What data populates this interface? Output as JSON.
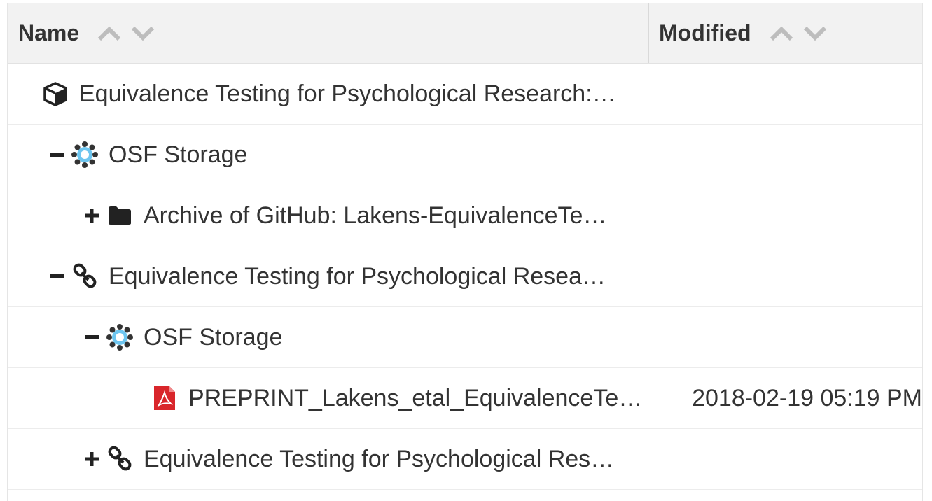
{
  "header": {
    "name_label": "Name",
    "modified_label": "Modified"
  },
  "rows": [
    {
      "label": "Equivalence Testing for Psychological Research:…",
      "icon": "cube-icon",
      "toggle": "",
      "modified": ""
    },
    {
      "label": "OSF Storage",
      "icon": "osf-storage-icon",
      "toggle": "collapse",
      "modified": ""
    },
    {
      "label": "Archive of GitHub: Lakens-EquivalenceTe…",
      "icon": "folder-icon",
      "toggle": "expand",
      "modified": ""
    },
    {
      "label": "Equivalence Testing for Psychological Resea…",
      "icon": "link-icon",
      "toggle": "collapse",
      "modified": ""
    },
    {
      "label": "OSF Storage",
      "icon": "osf-storage-icon",
      "toggle": "collapse",
      "modified": ""
    },
    {
      "label": "PREPRINT_Lakens_etal_EquivalenceTe…",
      "icon": "pdf-file-icon",
      "toggle": "",
      "modified": "2018-02-19 05:19 PM"
    },
    {
      "label": "Equivalence Testing for Psychological Res…",
      "icon": "link-icon",
      "toggle": "expand",
      "modified": ""
    }
  ]
}
